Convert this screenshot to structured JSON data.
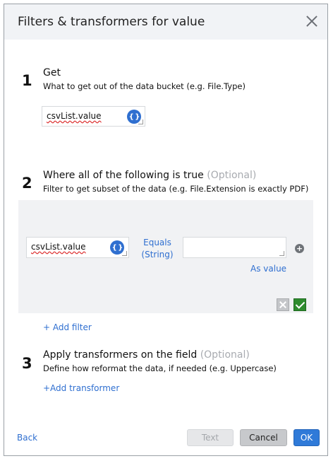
{
  "dialog": {
    "title": "Filters & transformers for value"
  },
  "step1": {
    "number": "1",
    "title": "Get",
    "description": "What to get out of the data bucket (e.g. File.Type)",
    "input_value": "csvList.value",
    "brace_label": "{ }"
  },
  "step2": {
    "number": "2",
    "title": "Where all of the following is true",
    "optional": "(Optional)",
    "description": "Filter to get subset of the data (e.g. File.Extension is exactly PDF)",
    "filter": {
      "input_value": "csvList.value",
      "brace_label": "{ }",
      "operator_line1": "Equals",
      "operator_line2": "(String)",
      "right_value": "",
      "as_value_label": "As value",
      "add_icon": "plus-circle-icon"
    },
    "add_filter_label": "+ Add filter"
  },
  "step3": {
    "number": "3",
    "title": "Apply transformers on the field",
    "optional": "(Optional)",
    "description": "Define how reformat the data, if needed (e.g. Uppercase)",
    "add_transformer_label": "+Add transformer"
  },
  "footer": {
    "back_label": "Back",
    "text_label": "Text",
    "cancel_label": "Cancel",
    "ok_label": "OK"
  },
  "colors": {
    "accent": "#2f6fd0",
    "ok_button": "#2f7ad8",
    "check_green": "#2e8b2e",
    "header_bg": "#f1f3f6"
  }
}
